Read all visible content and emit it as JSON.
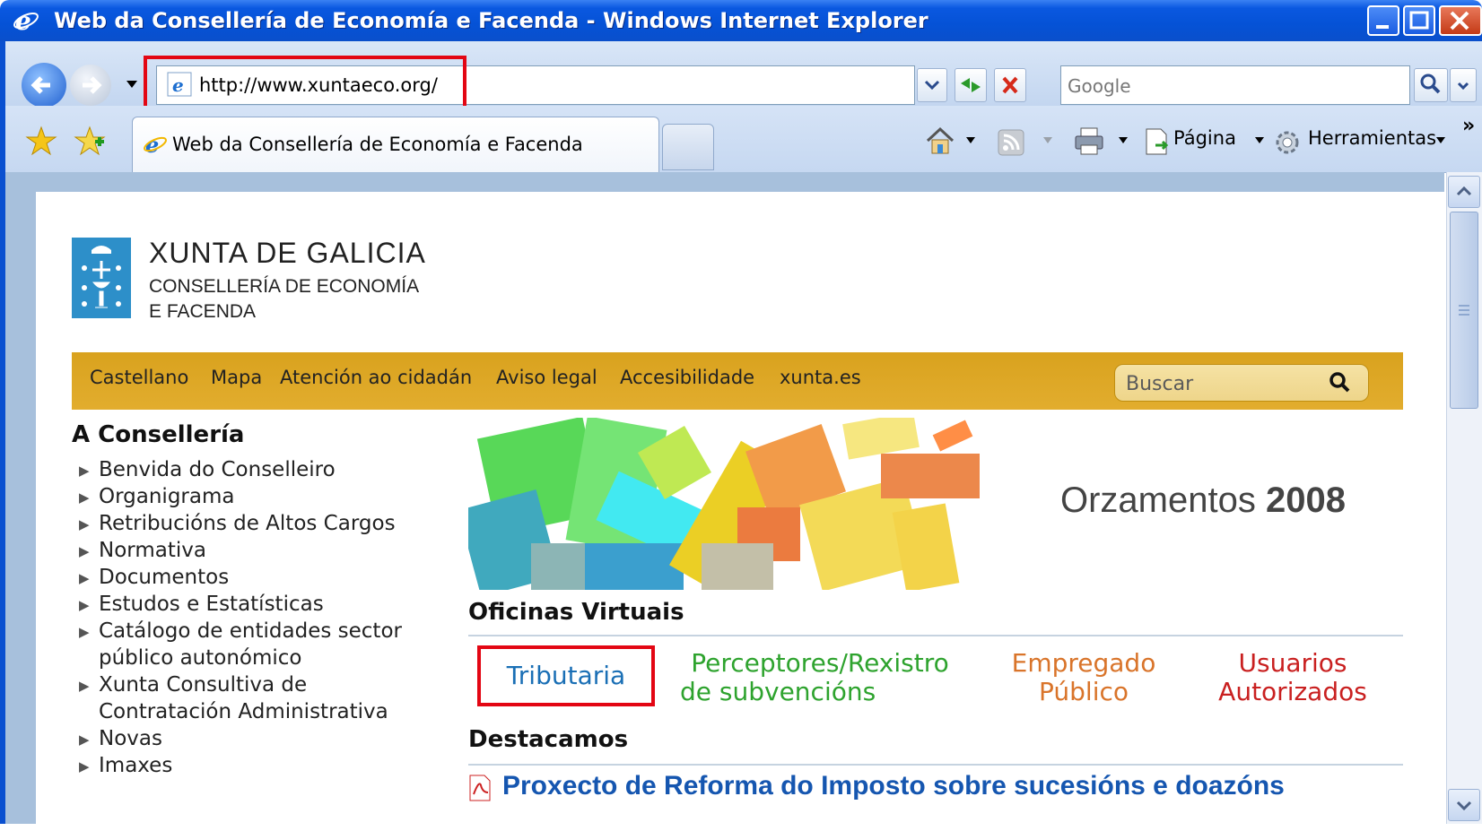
{
  "window": {
    "title": "Web da Consellería de Economía e Facenda - Windows Internet Explorer"
  },
  "addressbar": {
    "url": "http://www.xuntaeco.org/",
    "search_placeholder": "Google"
  },
  "tabs": [
    {
      "label": "Web da Consellería de Economía e Facenda",
      "active": true
    }
  ],
  "toolbar": {
    "page_label": "Página",
    "tools_label": "Herramientas",
    "chevron": "»"
  },
  "site": {
    "org_name": "XUNTA DE GALICIA",
    "dept_line1": "CONSELLERÍA DE ECONOMÍA",
    "dept_line2": "E FACENDA",
    "menu": [
      "Castellano",
      "Mapa",
      "Atención ao cidadán",
      "Aviso legal",
      "Accesibilidade",
      "xunta.es"
    ],
    "search_placeholder": "Buscar",
    "sidebar_title": "A Consellería",
    "sidebar_items": [
      "Benvida do Conselleiro",
      "Organigrama",
      "Retribucións de Altos Cargos",
      "Normativa",
      "Documentos",
      "Estudos e Estatísticas",
      "Catálogo de entidades sector",
      "público autonómico",
      "Xunta Consultiva de",
      "Contratación Administrativa",
      "Novas",
      "Imaxes"
    ],
    "banner_title_light": "Orzamentos",
    "banner_title_bold": "2008",
    "offices_heading": "Oficinas Virtuais",
    "offices": [
      {
        "line1": "Tributaria",
        "line2": "",
        "color": "#1a6fb5"
      },
      {
        "line1": "Perceptores/Rexistro",
        "line2": "de subvencións",
        "color": "#2ea32e"
      },
      {
        "line1": "Empregado",
        "line2": "Público",
        "color": "#d9742a"
      },
      {
        "line1": "Usuarios",
        "line2": "Autorizados",
        "color": "#c92020"
      }
    ],
    "featured_heading": "Destacamos",
    "featured_link": "Proxecto de Reforma do Imposto sobre sucesións e doazóns"
  },
  "colors": {
    "highlight": "#e30613",
    "menubar": "#e0aa2a",
    "titlebar": "#0a58e0",
    "link": "#1556b0"
  }
}
